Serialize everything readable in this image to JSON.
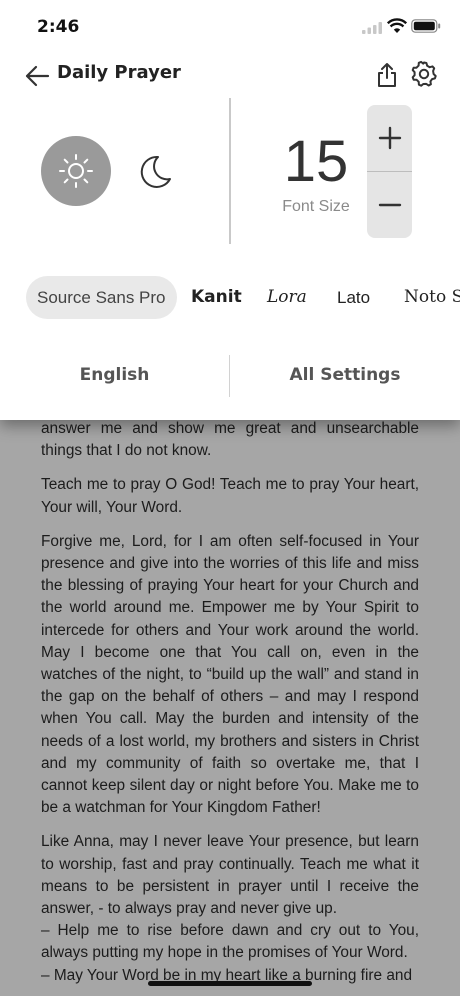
{
  "status_bar": {
    "time": "2:46"
  },
  "nav": {
    "title": "Daily Prayer"
  },
  "icons": {
    "back": "arrow-left-icon",
    "share": "share-icon",
    "settings": "gear-icon",
    "light_mode": "sun-icon",
    "dark_mode": "moon-icon",
    "increase": "plus-icon",
    "decrease": "minus-icon"
  },
  "theme": {
    "selected": "light",
    "selected_bg": "#9a9a9a"
  },
  "font_size": {
    "value": "15",
    "label": "Font Size"
  },
  "fonts": {
    "selected": "Source Sans Pro",
    "options": [
      "Source Sans Pro",
      "Kanit",
      "Lora",
      "Lato",
      "Noto S"
    ]
  },
  "footer": {
    "language": "English",
    "all_settings": "All Settings"
  },
  "content": {
    "paragraphs": [
      "answer me and show me great and unsearchable things that I do not know.",
      "Teach me to pray O God! Teach me to pray Your heart, Your will, Your Word.",
      "Forgive me, Lord, for I am often self-focused in Your presence and give into the worries of this life and miss the blessing of praying Your heart for your Church and the world around me. Empower me by Your Spirit to intercede for others and Your work around the world. May I become one that You call on, even in the watches of the night, to “build up the wall” and stand in the gap on the behalf of others – and may I respond when You call. May the burden and intensity of the needs of a lost world, my brothers and sisters in Christ and my community of faith so overtake me, that I cannot keep silent day or night before You. Make me to be a watchman for Your Kingdom Father!"
    ],
    "last_lines": [
      "Like Anna, may I never leave Your presence, but learn to worship, fast and pray continually. Teach me what it means to be persistent in prayer until I receive the answer, - to always pray and never give up.",
      "– Help me to rise before dawn and cry out to You, always putting my hope in the promises of Your Word.",
      "– May Your Word be in my heart like a burning fire and"
    ]
  }
}
